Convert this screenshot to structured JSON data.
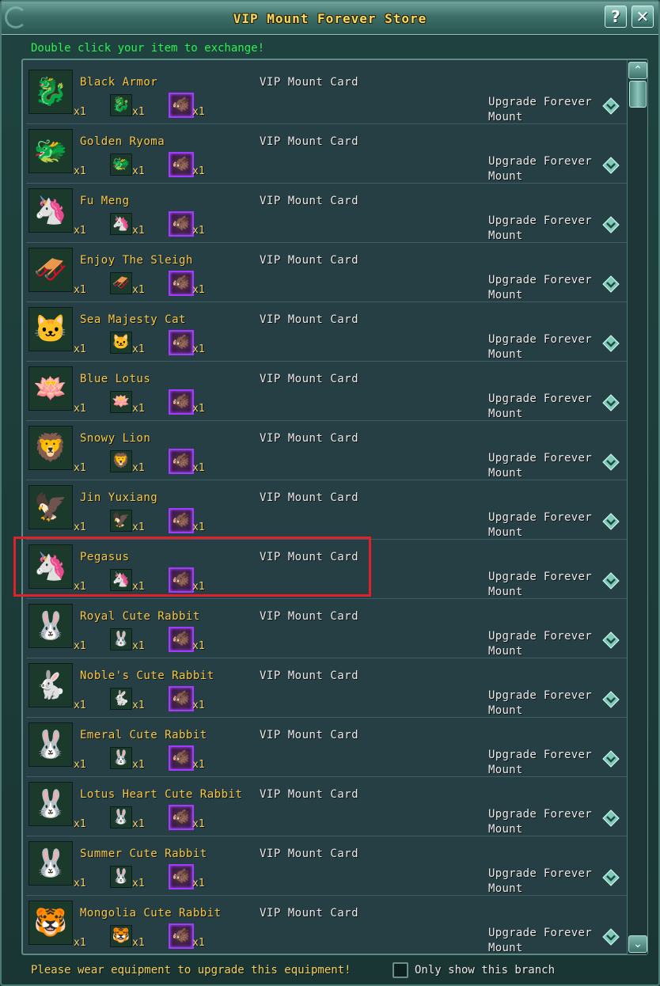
{
  "window": {
    "title": "VIP Mount Forever Store",
    "help_label": "?",
    "close_label": "✕"
  },
  "instructions": "Double click your item to exchange!",
  "card_name": "VIP Mount Card",
  "upgrade_label": "Upgrade Forever Mount",
  "items": [
    {
      "name": "Black Armor",
      "qty_big": "x1",
      "qty_small": "x1",
      "qty_card": "x1",
      "icon": "🐉"
    },
    {
      "name": "Golden Ryoma",
      "qty_big": "x1",
      "qty_small": "x1",
      "qty_card": "x1",
      "icon": "🐲"
    },
    {
      "name": "Fu Meng",
      "qty_big": "x1",
      "qty_small": "x1",
      "qty_card": "x1",
      "icon": "🦄"
    },
    {
      "name": "Enjoy The Sleigh",
      "qty_big": "x1",
      "qty_small": "x1",
      "qty_card": "x1",
      "icon": "🛷"
    },
    {
      "name": "Sea Majesty Cat",
      "qty_big": "x1",
      "qty_small": "x1",
      "qty_card": "x1",
      "icon": "🐱"
    },
    {
      "name": "Blue Lotus",
      "qty_big": "x1",
      "qty_small": "x1",
      "qty_card": "x1",
      "icon": "🪷"
    },
    {
      "name": "Snowy Lion",
      "qty_big": "x1",
      "qty_small": "x1",
      "qty_card": "x1",
      "icon": "🦁"
    },
    {
      "name": "Jin Yuxiang",
      "qty_big": "x1",
      "qty_small": "x1",
      "qty_card": "x1",
      "icon": "🦅"
    },
    {
      "name": "Pegasus",
      "qty_big": "x1",
      "qty_small": "x1",
      "qty_card": "x1",
      "icon": "🦄"
    },
    {
      "name": "Royal Cute Rabbit",
      "qty_big": "x1",
      "qty_small": "x1",
      "qty_card": "x1",
      "icon": "🐰"
    },
    {
      "name": "Noble's Cute Rabbit",
      "qty_big": "x1",
      "qty_small": "x1",
      "qty_card": "x1",
      "icon": "🐇"
    },
    {
      "name": "Emeral Cute Rabbit",
      "qty_big": "x1",
      "qty_small": "x1",
      "qty_card": "x1",
      "icon": "🐰"
    },
    {
      "name": "Lotus Heart Cute Rabbit",
      "qty_big": "x1",
      "qty_small": "x1",
      "qty_card": "x1",
      "icon": "🐰"
    },
    {
      "name": "Summer Cute Rabbit",
      "qty_big": "x1",
      "qty_small": "x1",
      "qty_card": "x1",
      "icon": "🐰"
    },
    {
      "name": "Mongolia Cute Rabbit",
      "qty_big": "x1",
      "qty_small": "x1",
      "qty_card": "x1",
      "icon": "🐯"
    }
  ],
  "card_icon": "🐗",
  "scroll": {
    "up": "⌃",
    "down": "⌄"
  },
  "footer": {
    "note": "Please wear equipment to upgrade this equipment!",
    "branch_label": "Only show this branch",
    "branch_checked": false
  },
  "colors": {
    "highlight": "#e0202a",
    "name_gold": "#f7c948",
    "instruction_green": "#2bf24d"
  }
}
